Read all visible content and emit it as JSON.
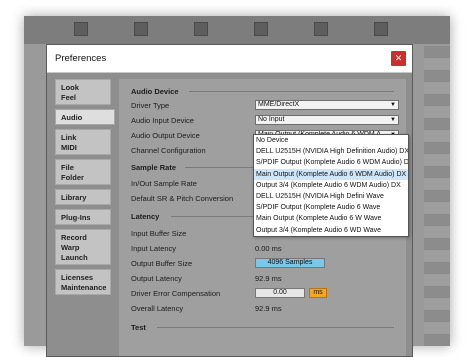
{
  "window": {
    "title": "Preferences",
    "close_glyph": "✕"
  },
  "sidebar": {
    "items": [
      {
        "label": "Look\nFeel"
      },
      {
        "label": "Audio"
      },
      {
        "label": "Link\nMIDI"
      },
      {
        "label": "File\nFolder"
      },
      {
        "label": "Library"
      },
      {
        "label": "Plug-Ins"
      },
      {
        "label": "Record\nWarp\nLaunch"
      },
      {
        "label": "Licenses\nMaintenance"
      }
    ]
  },
  "audio": {
    "device_section": "Audio Device",
    "driver_type_label": "Driver Type",
    "driver_type_value": "MME/DirectX",
    "input_device_label": "Audio Input Device",
    "input_device_value": "No Input",
    "output_device_label": "Audio Output Device",
    "output_device_value": "Main Output (Komplete Audio 6 WDM A",
    "channel_config_label": "Channel Configuration",
    "sample_rate_section": "Sample Rate",
    "in_out_sample_rate_label": "In/Out Sample Rate",
    "default_sr_label": "Default SR & Pitch Conversion",
    "latency_section": "Latency",
    "input_buffer_label": "Input Buffer Size",
    "input_latency_label": "Input Latency",
    "input_latency_value": "0.00 ms",
    "output_buffer_label": "Output Buffer Size",
    "output_buffer_value": "4096",
    "output_buffer_unit": "Samples",
    "output_latency_label": "Output Latency",
    "output_latency_value": "92.9 ms",
    "driver_error_label": "Driver Error Compensation",
    "driver_error_value": "0.00",
    "driver_error_unit": "ms",
    "overall_latency_label": "Overall Latency",
    "overall_latency_value": "92.9 ms",
    "test_section": "Test"
  },
  "dropdown": {
    "options": [
      "No Device",
      "DELL U2515H (NVIDIA High Definition Audio) DX",
      "S/PDIF Output (Komplete Audio 6 WDM Audio) DX",
      "Main Output (Komplete Audio 6 WDM Audio) DX",
      "Output 3/4 (Komplete Audio 6 WDM Audio) DX",
      "DELL U2515H (NVIDIA High Defini Wave",
      "S/PDIF Output (Komplete Audio 6 Wave",
      "Main Output (Komplete Audio 6 W Wave",
      "Output 3/4 (Komplete Audio 6 WD Wave"
    ],
    "selected_index": 3
  },
  "colors": {
    "close": "#c9302c",
    "highlight_field": "#7bc7e8",
    "ms_button": "#f4a623",
    "dropdown_selected": "#cfe6f8"
  }
}
